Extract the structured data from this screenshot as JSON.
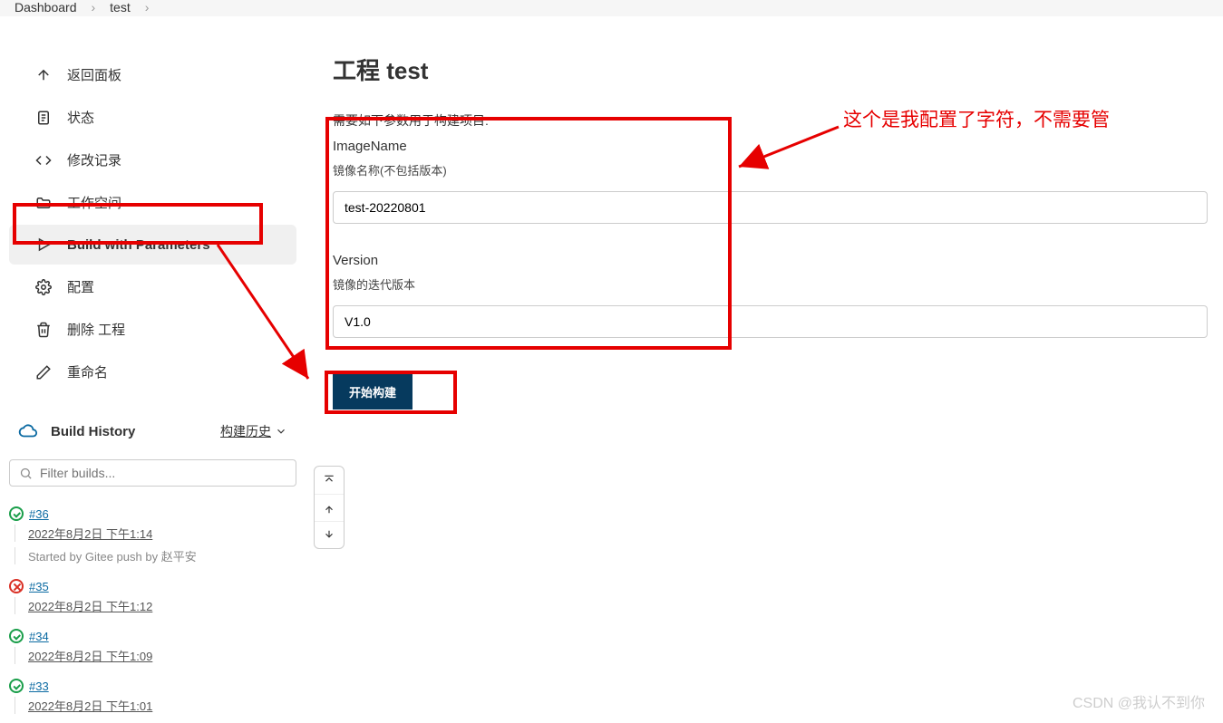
{
  "breadcrumb": {
    "items": [
      "Dashboard",
      "test"
    ]
  },
  "sidebar": {
    "items": [
      {
        "label": "返回面板"
      },
      {
        "label": "状态"
      },
      {
        "label": "修改记录"
      },
      {
        "label": "工作空间"
      },
      {
        "label": "Build with Parameters"
      },
      {
        "label": "配置"
      },
      {
        "label": "删除 工程"
      },
      {
        "label": "重命名"
      }
    ]
  },
  "history": {
    "title": "Build History",
    "trend_label": "构建历史",
    "filter_placeholder": "Filter builds...",
    "builds": [
      {
        "num": "#36",
        "time": "2022年8月2日 下午1:14",
        "cause": "Started by Gitee push by 赵平安",
        "status": "ok"
      },
      {
        "num": "#35",
        "time": "2022年8月2日 下午1:12",
        "status": "fail"
      },
      {
        "num": "#34",
        "time": "2022年8月2日 下午1:09",
        "status": "ok"
      },
      {
        "num": "#33",
        "time": "2022年8月2日 下午1:01",
        "status": "ok"
      }
    ]
  },
  "main": {
    "title": "工程 test",
    "intro": "需要如下参数用于构建项目:",
    "params": [
      {
        "name": "ImageName",
        "desc": "镜像名称(不包括版本)",
        "value": "test-20220801"
      },
      {
        "name": "Version",
        "desc": "镜像的迭代版本",
        "value": "V1.0"
      }
    ],
    "submit_label": "开始构建"
  },
  "annotation_text": "这个是我配置了字符，不需要管",
  "watermark": "CSDN @我认不到你"
}
